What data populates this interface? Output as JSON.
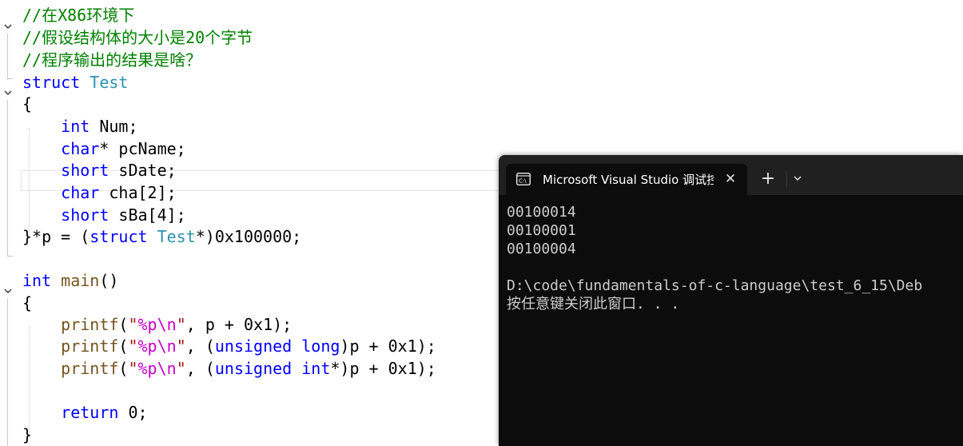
{
  "editor": {
    "lines": [
      [
        {
          "t": "//在X86环境下",
          "c": "comment"
        }
      ],
      [
        {
          "t": "//假设结构体的大小是20个字节",
          "c": "comment"
        }
      ],
      [
        {
          "t": "//程序输出的结果是啥？",
          "c": "comment"
        }
      ],
      [
        {
          "t": "struct",
          "c": "keyword"
        },
        {
          "t": " ",
          "c": "plain"
        },
        {
          "t": "Test",
          "c": "type"
        }
      ],
      [
        {
          "t": "{",
          "c": "plain"
        }
      ],
      [
        {
          "t": "    ",
          "c": "plain"
        },
        {
          "t": "int",
          "c": "keyword"
        },
        {
          "t": " Num;",
          "c": "plain"
        }
      ],
      [
        {
          "t": "    ",
          "c": "plain"
        },
        {
          "t": "char",
          "c": "keyword"
        },
        {
          "t": "* pcName;",
          "c": "plain"
        }
      ],
      [
        {
          "t": "    ",
          "c": "plain"
        },
        {
          "t": "short",
          "c": "keyword"
        },
        {
          "t": " sDate;",
          "c": "plain"
        }
      ],
      [
        {
          "t": "    ",
          "c": "plain"
        },
        {
          "t": "char",
          "c": "keyword"
        },
        {
          "t": " cha[2];",
          "c": "plain"
        }
      ],
      [
        {
          "t": "    ",
          "c": "plain"
        },
        {
          "t": "short",
          "c": "keyword"
        },
        {
          "t": " sBa[4];",
          "c": "plain"
        }
      ],
      [
        {
          "t": "}*p = (",
          "c": "plain"
        },
        {
          "t": "struct",
          "c": "keyword"
        },
        {
          "t": " ",
          "c": "plain"
        },
        {
          "t": "Test",
          "c": "type"
        },
        {
          "t": "*)0x100000;",
          "c": "plain"
        }
      ],
      [],
      [
        {
          "t": "int",
          "c": "keyword"
        },
        {
          "t": " ",
          "c": "plain"
        },
        {
          "t": "main",
          "c": "func"
        },
        {
          "t": "()",
          "c": "plain"
        }
      ],
      [
        {
          "t": "{",
          "c": "plain"
        }
      ],
      [
        {
          "t": "    ",
          "c": "plain"
        },
        {
          "t": "printf",
          "c": "func"
        },
        {
          "t": "(",
          "c": "plain"
        },
        {
          "t": "\"",
          "c": "string"
        },
        {
          "t": "%p",
          "c": "format"
        },
        {
          "t": "\\n",
          "c": "format"
        },
        {
          "t": "\"",
          "c": "string"
        },
        {
          "t": ", p + 0x1);",
          "c": "plain"
        }
      ],
      [
        {
          "t": "    ",
          "c": "plain"
        },
        {
          "t": "printf",
          "c": "func"
        },
        {
          "t": "(",
          "c": "plain"
        },
        {
          "t": "\"",
          "c": "string"
        },
        {
          "t": "%p",
          "c": "format"
        },
        {
          "t": "\\n",
          "c": "format"
        },
        {
          "t": "\"",
          "c": "string"
        },
        {
          "t": ", (",
          "c": "plain"
        },
        {
          "t": "unsigned",
          "c": "keyword"
        },
        {
          "t": " ",
          "c": "plain"
        },
        {
          "t": "long",
          "c": "keyword"
        },
        {
          "t": ")p + 0x1);",
          "c": "plain"
        }
      ],
      [
        {
          "t": "    ",
          "c": "plain"
        },
        {
          "t": "printf",
          "c": "func"
        },
        {
          "t": "(",
          "c": "plain"
        },
        {
          "t": "\"",
          "c": "string"
        },
        {
          "t": "%p",
          "c": "format"
        },
        {
          "t": "\\n",
          "c": "format"
        },
        {
          "t": "\"",
          "c": "string"
        },
        {
          "t": ", (",
          "c": "plain"
        },
        {
          "t": "unsigned",
          "c": "keyword"
        },
        {
          "t": " ",
          "c": "plain"
        },
        {
          "t": "int",
          "c": "keyword"
        },
        {
          "t": "*)p + 0x1);",
          "c": "plain"
        }
      ],
      [],
      [
        {
          "t": "    ",
          "c": "plain"
        },
        {
          "t": "return",
          "c": "keyword"
        },
        {
          "t": " 0;",
          "c": "plain"
        }
      ],
      [
        {
          "t": "}",
          "c": "plain"
        }
      ]
    ],
    "colors": {
      "comment": "#008000",
      "keyword": "#0000ff",
      "type": "#2b91af",
      "function": "#74531f",
      "string": "#a31515",
      "format": "#c800c8"
    },
    "fold_icons": [
      "chevron-down-icon",
      "chevron-down-icon",
      "chevron-down-icon"
    ]
  },
  "terminal": {
    "tab_title": "Microsoft Visual Studio 调试控",
    "close_symbol": "✕",
    "new_tab_symbol": "+",
    "output": [
      "00100014",
      "00100001",
      "00100004",
      "",
      "D:\\code\\fundamentals-of-c-language\\test_6_15\\Deb",
      "按任意键关闭此窗口. . ."
    ],
    "colors": {
      "background": "#0c0c0c",
      "titlebar": "#202020",
      "text": "#cccccc"
    }
  }
}
